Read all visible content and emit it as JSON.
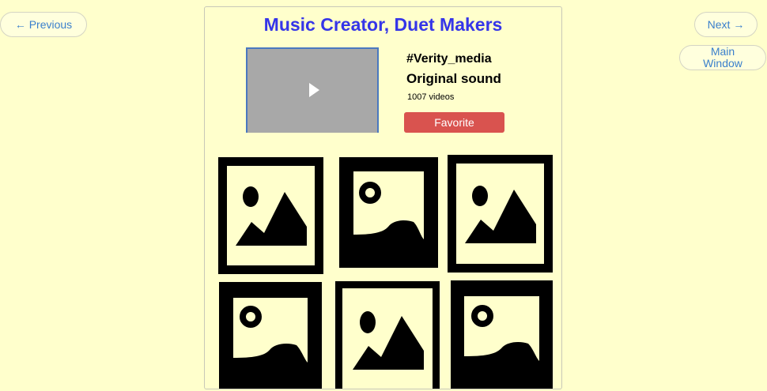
{
  "nav": {
    "previous_label": "← Previous",
    "next_label": "Next →",
    "main_window_label": "Main Window"
  },
  "header": {
    "title": "Music Creator, Duet Makers"
  },
  "sound": {
    "handle": "#Verity_media",
    "name": "Original sound",
    "video_count": "1007 videos",
    "favorite_label": "Favorite"
  },
  "video_player": {
    "icon": "play-icon"
  },
  "thumbnails": [
    {
      "icon": "mountain-image-icon"
    },
    {
      "icon": "landscape-image-icon"
    },
    {
      "icon": "mountain-image-icon"
    },
    {
      "icon": "landscape-image-icon"
    },
    {
      "icon": "mountain-image-icon"
    },
    {
      "icon": "landscape-image-icon"
    }
  ],
  "colors": {
    "background": "#ffffcc",
    "title": "#3535e8",
    "favorite_button": "#d9534f",
    "link": "#3a7fcc"
  }
}
